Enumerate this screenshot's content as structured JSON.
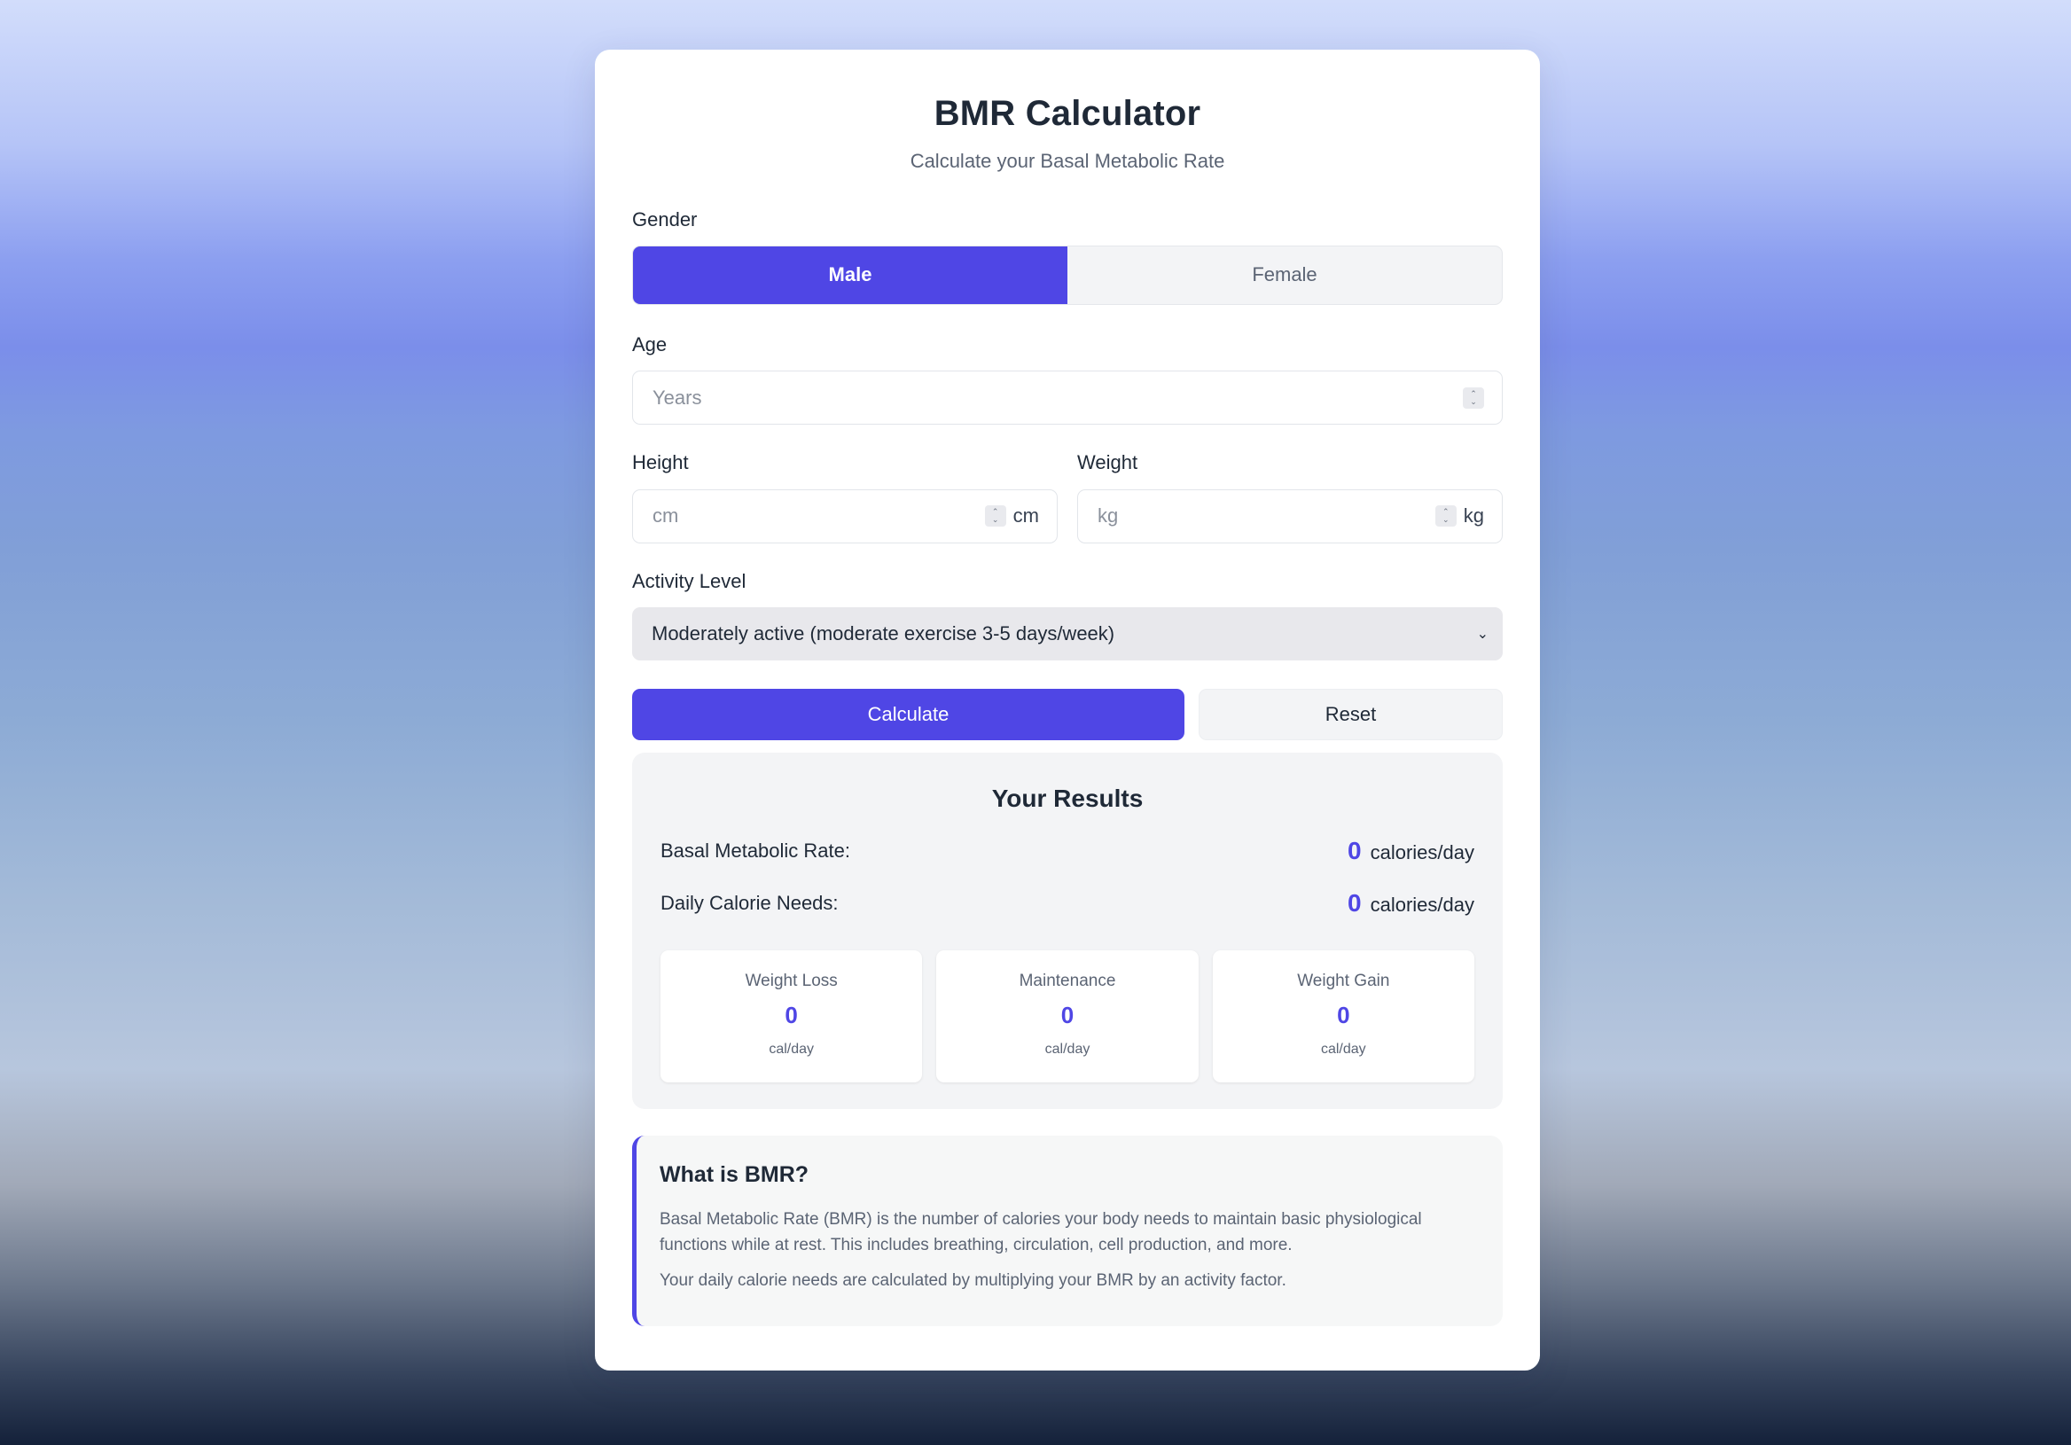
{
  "header": {
    "title": "BMR Calculator",
    "subtitle": "Calculate your Basal Metabolic Rate"
  },
  "gender": {
    "label": "Gender",
    "options": [
      "Male",
      "Female"
    ],
    "selected": "Male"
  },
  "age": {
    "label": "Age",
    "placeholder": "Years",
    "value": ""
  },
  "height": {
    "label": "Height",
    "placeholder": "cm",
    "unit": "cm",
    "value": ""
  },
  "weight": {
    "label": "Weight",
    "placeholder": "kg",
    "unit": "kg",
    "value": ""
  },
  "activity": {
    "label": "Activity Level",
    "selected": "Moderately active (moderate exercise 3-5 days/week)"
  },
  "actions": {
    "calculate": "Calculate",
    "reset": "Reset"
  },
  "results": {
    "title": "Your Results",
    "bmr_label": "Basal Metabolic Rate:",
    "bmr_value": "0",
    "bmr_unit": "calories/day",
    "daily_label": "Daily Calorie Needs:",
    "daily_value": "0",
    "daily_unit": "calories/day",
    "goals": [
      {
        "label": "Weight Loss",
        "value": "0",
        "unit": "cal/day"
      },
      {
        "label": "Maintenance",
        "value": "0",
        "unit": "cal/day"
      },
      {
        "label": "Weight Gain",
        "value": "0",
        "unit": "cal/day"
      }
    ]
  },
  "info": {
    "title": "What is BMR?",
    "paragraphs": [
      "Basal Metabolic Rate (BMR) is the number of calories your body needs to maintain basic physiological functions while at rest. This includes breathing, circulation, cell production, and more.",
      "Your daily calorie needs are calculated by multiplying your BMR by an activity factor."
    ]
  },
  "colors": {
    "accent": "#4f46e5",
    "text": "#1f2937",
    "muted": "#5b6474"
  }
}
